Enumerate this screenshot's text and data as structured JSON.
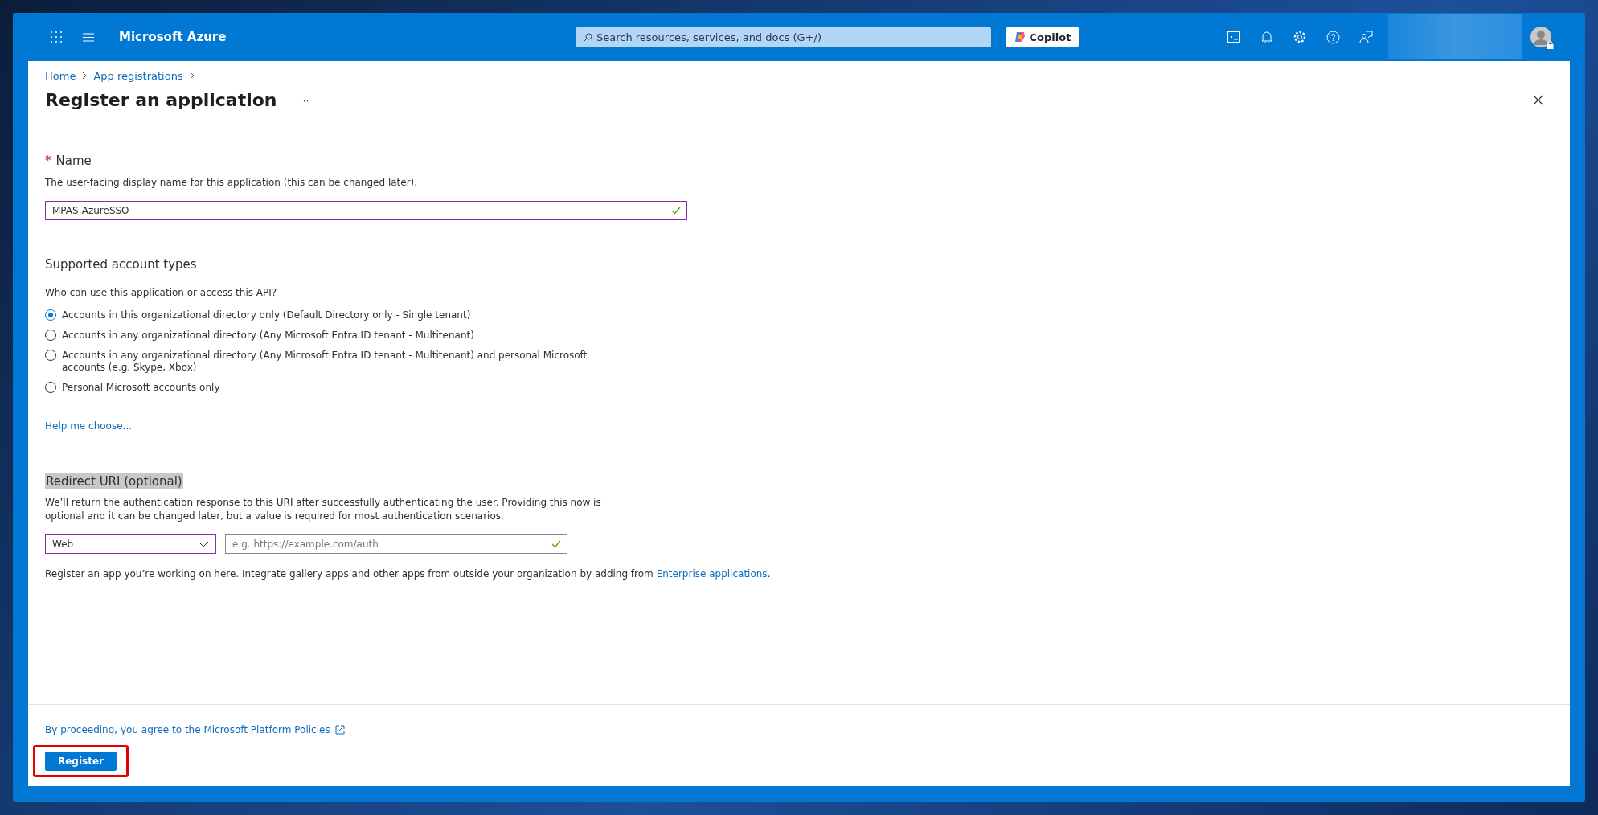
{
  "top_bar": {
    "brand": "Microsoft Azure",
    "search": {
      "placeholder": "Search resources, services, and docs (G+/)"
    },
    "copilot": "Copilot"
  },
  "breadcrumb": [
    "Home",
    "App registrations"
  ],
  "title": "Register an application",
  "more": "···",
  "name_section": {
    "required_mark": "*",
    "label": "Name",
    "description": "The user-facing display name for this application (this can be changed later).",
    "value": "MPAS-AzureSSO",
    "valid": true
  },
  "account_types": {
    "heading": "Supported account types",
    "question": "Who can use this application or access this API?",
    "options": [
      {
        "label": "Accounts in this organizational directory only (Default Directory only - Single tenant)",
        "selected": true
      },
      {
        "label": "Accounts in any organizational directory (Any Microsoft Entra ID tenant - Multitenant)",
        "selected": false
      },
      {
        "label": "Accounts in any organizational directory (Any Microsoft Entra ID tenant - Multitenant) and personal Microsoft accounts (e.g. Skype, Xbox)",
        "selected": false
      },
      {
        "label": "Personal Microsoft accounts only",
        "selected": false
      }
    ],
    "help_link": "Help me choose..."
  },
  "redirect": {
    "heading": "Redirect URI (optional)",
    "description": "We’ll return the authentication response to this URI after successfully authenticating the user. Providing this now is optional and it can be changed later, but a value is required for most authentication scenarios.",
    "platform": "Web",
    "uri": {
      "placeholder": "e.g. https://example.com/auth",
      "valid": true
    }
  },
  "note": {
    "text": "Register an app you’re working on here. Integrate gallery apps and other apps from outside your organization by adding from",
    "link": "Enterprise applications",
    "end": "."
  },
  "footer": {
    "policies_link": "By proceeding, you agree to the Microsoft Platform Policies",
    "register_button": "Register"
  }
}
